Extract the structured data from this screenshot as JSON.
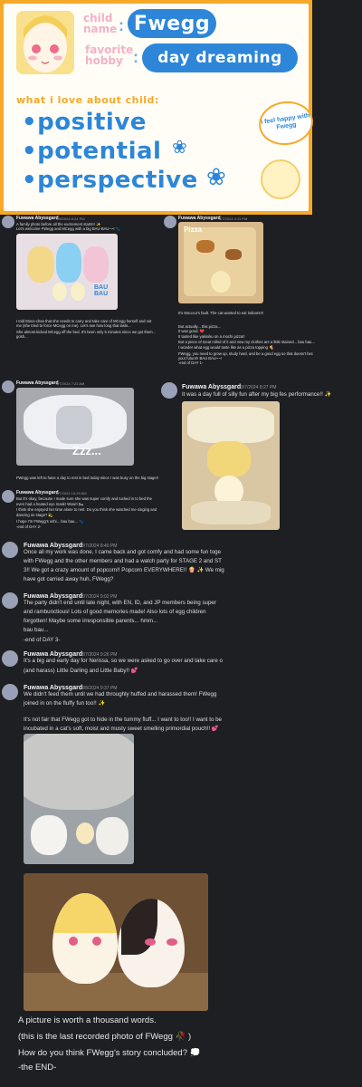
{
  "card": {
    "child_label": "child\nname",
    "hobby_label": "favorite\nhobby",
    "child_name": "Fwegg",
    "hobby": "day dreaming",
    "love_title": "what i love about child:",
    "traits": [
      "•positive",
      "•potential",
      "•perspective"
    ],
    "bubble_text": "i feel happy with Fwegg"
  },
  "posts": [
    {
      "user": "Fuwawa Abyssgard",
      "time": "3/6/2024 8:24 PM",
      "lines": [
        "A family photo before all the excitement starts!! ✨",
        "Let's welcome FWegg and MCegg with a big BAU-BAU~~! 🐾"
      ],
      "lines2": [
        "I told Moco-chan that she needs to carry and take care of MCegg herself and not",
        "me (she tried to force MCegg on me). Let's see how long that lasts...",
        "She almost kicked MCegg off the bed. It's been only 5 minutes since we got them...",
        "gosh..."
      ],
      "photo_label": "BAU BAU"
    },
    {
      "user": "Fuwawa Abyssgard",
      "time": "3/7/2024 4:11 PM",
      "lines": [
        "It's Mococo's fault. The cat wanted to eat indoors!!!",
        "But actually... this pizza...",
        "It was good. 💔",
        "It tasted like yakiniku on a mochi pizza!!",
        "But a piece of meat rolled of it and now my clothes are a little stained... bau bau...",
        "I wonder what egg would taste like as a pizza topping 🍕",
        "FWegg, you need to grow up, study hard, and be a good egg so that doesn't bec",
        "your future!! BAU BAU~~!",
        "-end of DAY 1-"
      ],
      "photo_label": "Pizza"
    },
    {
      "user": "Fuwawa Abyssgard",
      "time": "3/7/2024 7:22 AM",
      "lines": [
        "FWegg was left to have a day to rest in bed today since I was busy on the big stage!!"
      ],
      "photo_label": "Zzz..."
    },
    {
      "user": "Fuwawa Abyssgard",
      "time": "3/7/2024 10:29 AM",
      "lines": [
        "But it's okay, because I made sure she was super comfy and tucked in to bed the",
        "even had a heated eye mask! Wow!! 🛏",
        "I think she enjoyed her time alone to rest. Do you think she watched me singing and",
        "dancing on stage? 💫",
        "I hope I'm FWegg's oshi... bau bau... 🐾",
        "-end of DAY 2-"
      ]
    },
    {
      "user": "Fuwawa Abyssgard",
      "time": "3/7/2024 8:27 PM",
      "lines": [
        "It was a day full of silly fun after my big fes performance!! ✨"
      ]
    },
    {
      "user": "Fuwawa Abyssgard",
      "time": "3/7/2024 8:40 PM",
      "lines": [
        "Once all my work was done, I came back and got comfy and had some fun toge",
        "with FWegg and the other members and had a watch party for STAGE 2 and ST",
        "3!! We got a crazy amount of popcorn!! Popcorn EVERYWHERE!! 🍿 ✨ We mig",
        "have got carried away huh, FWegg?"
      ]
    },
    {
      "user": "Fuwawa Abyssgard",
      "time": "3/7/2024 9:02 PM",
      "lines": [
        "The party didn't end until late night, with EN, ID, and JP members being super",
        "and rambunctious! Lots of good memories made! Also lots of egg children",
        "forgotten! Maybe some irresponsible parents... hmm...",
        "bau bau...",
        "-end of DAY 3-"
      ]
    },
    {
      "user": "Fuwawa Abyssgard",
      "time": "3/7/2024 9:26 PM",
      "lines": [
        "It's a big and early day for Nerissa, so we were asked to go over and take care o",
        "(and harass) Little Darling and Little Baby!! 💕"
      ]
    },
    {
      "user": "Fuwawa Abyssgard",
      "time": "3/8/2024 9:37 PM",
      "lines": [
        "We didn't feed them until we had throughly huffed and harassed them! FWegg",
        "joined in on the fluffy fun too!! ✨",
        "",
        "It's not fair that FWegg got to hide in the tummy fluff... I want to too!! I want to be",
        "incubated in a cat's soft, moist and musty sweet smelling primordial pouch!! 💕"
      ]
    }
  ],
  "final_lines": [
    "A picture is worth a thousand words.",
    "(this is the last recorded photo of FWegg 🥀 )",
    "How do you think FWegg's story concluded? 💭",
    "-the END-"
  ],
  "colors": {
    "card_border": "#f6a928",
    "pill_blue": "#2d86d8",
    "label_pink": "#f2b2c8",
    "chat_bg": "#1e1f22"
  }
}
